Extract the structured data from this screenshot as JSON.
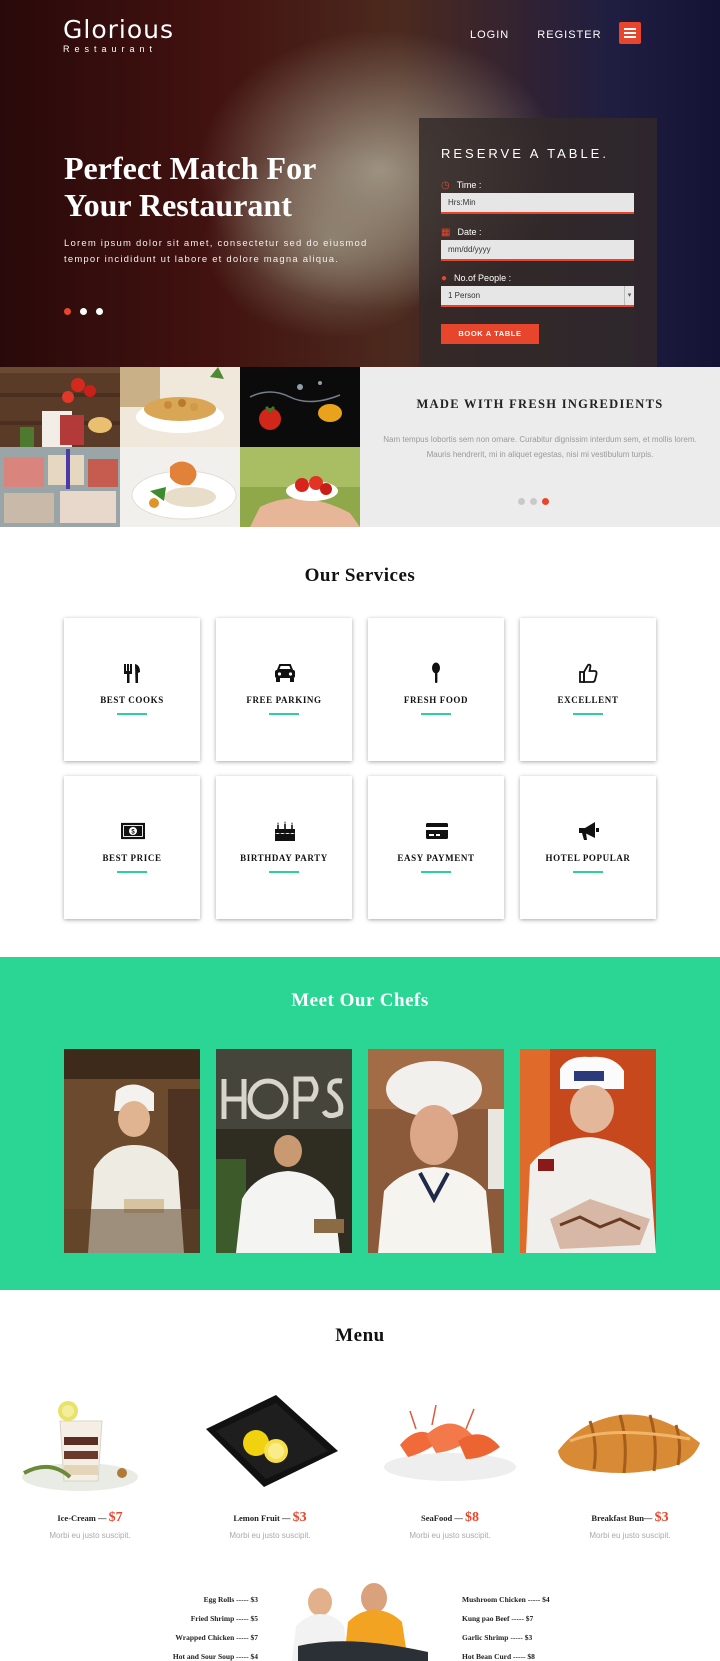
{
  "logo": {
    "title": "Glorious",
    "subtitle": "Restaurant"
  },
  "nav": {
    "login": "LOGIN",
    "register": "REGISTER"
  },
  "hero": {
    "title": "Perfect Match For Your Restaurant",
    "text": "Lorem ipsum dolor sit amet, consectetur sed do eiusmod tempor incididunt ut labore et dolore magna aliqua."
  },
  "reserve": {
    "title": "RESERVE A TABLE.",
    "time_label": "Time :",
    "time_value": "Hrs:Min",
    "date_label": "Date :",
    "date_value": "mm/dd/yyyy",
    "people_label": "No.of People :",
    "people_value": "1 Person",
    "button": "BOOK A TABLE"
  },
  "fresh": {
    "title": "MADE WITH FRESH INGREDIENTS",
    "text": "Nam tempus lobortis sem non ornare. Curabitur dignissim interdum sem, et mollis lorem. Mauris hendrerit, mi in aliquet egestas, nisi mi vestibulum turpis."
  },
  "services": {
    "title": "Our Services",
    "items": [
      {
        "label": "BEST COOKS",
        "icon": "cutlery-icon"
      },
      {
        "label": "FREE PARKING",
        "icon": "car-icon"
      },
      {
        "label": "FRESH FOOD",
        "icon": "spoon-icon"
      },
      {
        "label": "EXCELLENT",
        "icon": "thumbs-up-icon"
      },
      {
        "label": "BEST PRICE",
        "icon": "money-icon"
      },
      {
        "label": "BIRTHDAY PARTY",
        "icon": "birthday-cake-icon"
      },
      {
        "label": "EASY PAYMENT",
        "icon": "credit-card-icon"
      },
      {
        "label": "HOTEL POPULAR",
        "icon": "bullhorn-icon"
      }
    ]
  },
  "chefs": {
    "title": "Meet Our Chefs"
  },
  "menu": {
    "title": "Menu",
    "dishes": [
      {
        "name": "Ice-Cream —",
        "price": "$7",
        "desc": "Morbi eu justo suscipit."
      },
      {
        "name": "Lemon Fruit —",
        "price": "$3",
        "desc": "Morbi eu justo suscipit."
      },
      {
        "name": "SeaFood —",
        "price": "$8",
        "desc": "Morbi eu justo suscipit."
      },
      {
        "name": "Breakfast Bun—",
        "price": "$3",
        "desc": "Morbi eu justo suscipit."
      }
    ],
    "left_list": [
      "Egg Rolls ----- $3",
      "Fried Shrimp ----- $5",
      "Wrapped Chicken ----- $7",
      "Hot and Sour Soup ----- $4"
    ],
    "right_list": [
      "Mushroom Chicken ----- $4",
      "Kung pao Beef ----- $7",
      "Garlic Shrimp ----- $3",
      "Hot Bean Curd ----- $8"
    ]
  },
  "colors": {
    "accent": "#e8462c",
    "green": "#2bd593",
    "service_bar": "#2bd19a"
  }
}
